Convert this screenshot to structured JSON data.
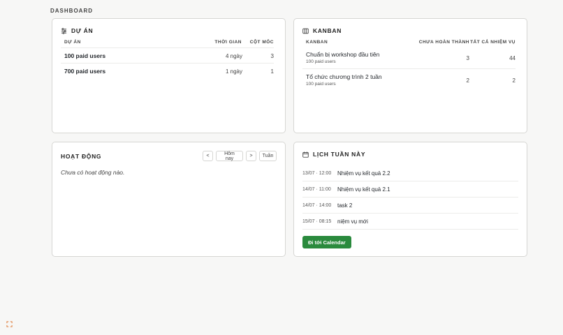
{
  "page": {
    "title": "DASHBOARD"
  },
  "projects": {
    "title": "DỰ ÁN",
    "columns": {
      "name": "DỰ ÁN",
      "time": "THỜI GIAN",
      "milestones": "CỘT MỐC"
    },
    "rows": [
      {
        "name": "100 paid users",
        "time": "4 ngày",
        "milestones": "3"
      },
      {
        "name": "700 paid users",
        "time": "1 ngày",
        "milestones": "1"
      }
    ]
  },
  "kanban": {
    "title": "KANBAN",
    "columns": {
      "name": "KANBAN",
      "incomplete": "CHƯA HOÀN THÀNH",
      "total": "TẤT CẢ NHIỆM VỤ"
    },
    "rows": [
      {
        "name": "Chuẩn bị workshop đầu tiên",
        "project": "100 paid users",
        "incomplete": "3",
        "total": "44"
      },
      {
        "name": "Tổ chức chương trình 2 tuần",
        "project": "100 paid users",
        "incomplete": "2",
        "total": "2"
      }
    ]
  },
  "activity": {
    "title": "HOẠT ĐỘNG",
    "prev": "<",
    "today": "Hôm nay",
    "next": ">",
    "range": "Tuần",
    "empty": "Chưa có hoạt động nào."
  },
  "week": {
    "title": "LỊCH TUẦN NÀY",
    "events": [
      {
        "time": "13/07 · 12:00",
        "title": "Nhiệm vụ kết quả 2.2"
      },
      {
        "time": "14/07 · 11:00",
        "title": "Nhiệm vụ kết quả 2.1"
      },
      {
        "time": "14/07 · 14:00",
        "title": "task 2"
      },
      {
        "time": "15/07 · 08:15",
        "title": "niệm vụ mới"
      }
    ],
    "button": "Đi tới Calendar",
    "button_color": "#2a8a3d"
  },
  "icons": {
    "projects": "sliders-icon",
    "kanban": "kanban-board-icon",
    "week": "calendar-icon",
    "corner": "expand-icon"
  }
}
